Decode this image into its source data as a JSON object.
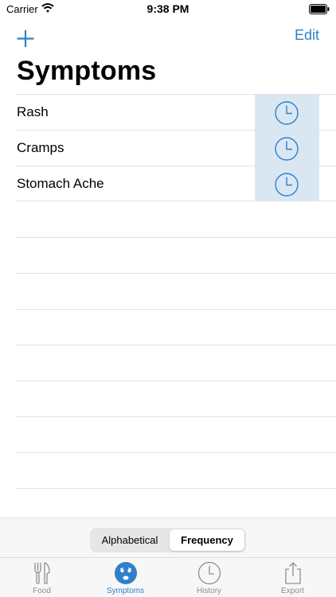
{
  "status": {
    "carrier": "Carrier",
    "time": "9:38 PM"
  },
  "nav": {
    "edit_label": "Edit"
  },
  "title": "Symptoms",
  "symptoms": [
    {
      "label": "Rash"
    },
    {
      "label": "Cramps"
    },
    {
      "label": "Stomach Ache"
    }
  ],
  "sort_control": {
    "options": [
      "Alphabetical",
      "Frequency"
    ],
    "selected": "Frequency"
  },
  "tabs": [
    {
      "label": "Food",
      "icon": "fork-knife-icon",
      "active": false
    },
    {
      "label": "Symptoms",
      "icon": "worried-face-icon",
      "active": true
    },
    {
      "label": "History",
      "icon": "clock-icon",
      "active": false
    },
    {
      "label": "Export",
      "icon": "share-icon",
      "active": false
    }
  ],
  "colors": {
    "accent": "#2f80c9",
    "row_action_bg": "#d9e7f3",
    "inactive": "#8e8e93"
  }
}
